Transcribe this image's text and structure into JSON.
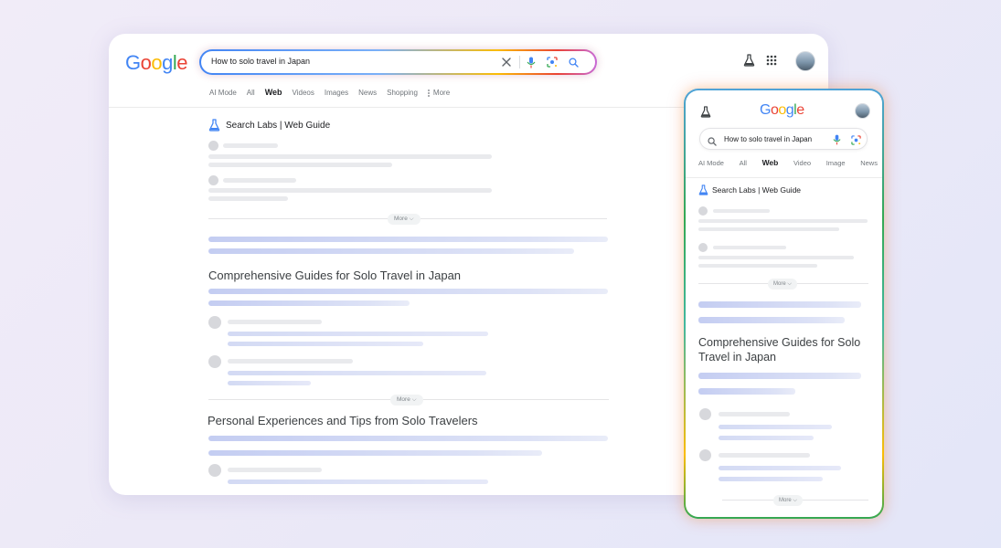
{
  "colors": {
    "google_blue": "#4285f4",
    "google_red": "#ea4335",
    "google_yellow": "#fbbc05",
    "google_green": "#34a853"
  },
  "logo": [
    "G",
    "o",
    "o",
    "g",
    "l",
    "e"
  ],
  "desktop": {
    "search": {
      "query": "How to solo travel in Japan",
      "icons": [
        "close-icon",
        "mic-icon",
        "lens-icon",
        "search-icon"
      ]
    },
    "header_icons": [
      "labs-flask-icon",
      "apps-grid-icon",
      "avatar"
    ],
    "tabs": [
      "AI Mode",
      "All",
      "Web",
      "Videos",
      "Images",
      "News",
      "Shopping",
      "More"
    ],
    "active_tab": "Web",
    "labs_label": "Search Labs | Web Guide",
    "more_label": "More",
    "headings": [
      "Comprehensive Guides for Solo Travel in Japan",
      "Personal Experiences and Tips from Solo Travelers"
    ]
  },
  "mobile": {
    "search": {
      "query": "How to solo travel in Japan",
      "icons": [
        "search-icon",
        "mic-icon",
        "lens-icon"
      ]
    },
    "tabs": [
      "AI Mode",
      "All",
      "Web",
      "Video",
      "Image",
      "News"
    ],
    "active_tab": "Web",
    "labs_label": "Search Labs | Web Guide",
    "more_label": "More",
    "headings": [
      "Comprehensive Guides for Solo Travel in Japan"
    ]
  }
}
